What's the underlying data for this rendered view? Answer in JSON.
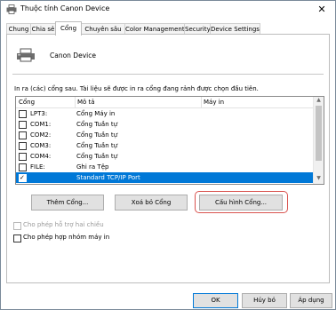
{
  "window": {
    "title": "Thuộc tính Canon Device",
    "close_glyph": "✕"
  },
  "tabs": [
    {
      "label": "Chung"
    },
    {
      "label": "Chia sẻ"
    },
    {
      "label": "Cổng"
    },
    {
      "label": "Chuyên sâu"
    },
    {
      "label": "Color Management"
    },
    {
      "label": "Security"
    },
    {
      "label": "Device Settings"
    }
  ],
  "active_tab": "Cổng",
  "device": {
    "name": "Canon Device",
    "icon": "printer-icon"
  },
  "instruction": "In ra (các) cổng sau. Tài liệu sẽ được in ra cổng đang rảnh được chọn đầu tiên.",
  "port_list": {
    "columns": [
      "Cổng",
      "Mô tả",
      "Máy in"
    ],
    "rows": [
      {
        "port": "LPT3:",
        "description": "Cổng Máy in",
        "printer": "",
        "checked": false,
        "selected": false
      },
      {
        "port": "COM1:",
        "description": "Cổng Tuần tự",
        "printer": "",
        "checked": false,
        "selected": false
      },
      {
        "port": "COM2:",
        "description": "Cổng Tuần tự",
        "printer": "",
        "checked": false,
        "selected": false
      },
      {
        "port": "COM3:",
        "description": "Cổng Tuần tự",
        "printer": "",
        "checked": false,
        "selected": false
      },
      {
        "port": "COM4:",
        "description": "Cổng Tuần tự",
        "printer": "",
        "checked": false,
        "selected": false
      },
      {
        "port": "FILE:",
        "description": "Ghi ra Tệp",
        "printer": "",
        "checked": false,
        "selected": false
      },
      {
        "port": "",
        "description": "Standard TCP/IP Port",
        "printer": "",
        "checked": true,
        "selected": true
      }
    ]
  },
  "buttons": {
    "add_port": "Thêm Cổng...",
    "delete_port": "Xoá bỏ Cổng",
    "configure_port": "Cấu hình Cổng..."
  },
  "options": {
    "bidirectional": {
      "label": "Cho phép hỗ trợ hai chiều",
      "checked": false,
      "enabled": false
    },
    "pooling": {
      "label": "Cho phép hợp nhóm máy in",
      "checked": false,
      "enabled": true
    }
  },
  "dialog_buttons": {
    "ok": "OK",
    "cancel": "Hủy bỏ",
    "apply": "Áp dụng"
  },
  "colors": {
    "selection": "#0078d7",
    "focus_highlight": "#d9534f"
  }
}
